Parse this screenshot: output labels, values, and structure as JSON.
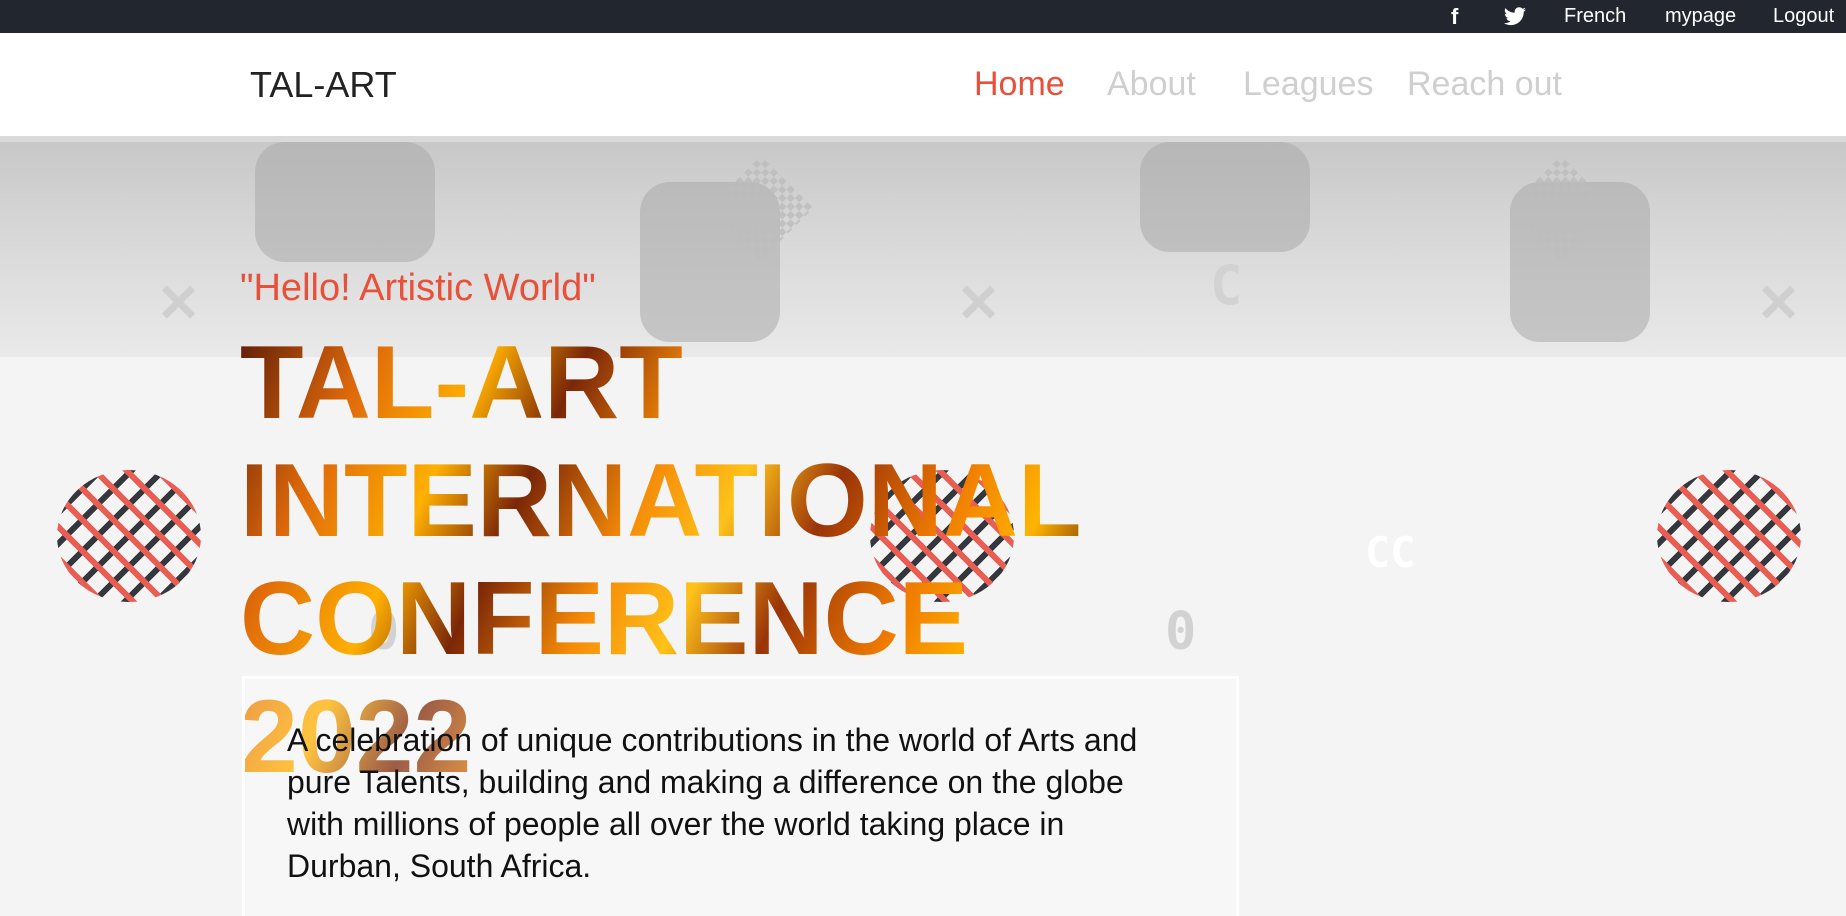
{
  "topbar": {
    "social": [
      {
        "icon": "facebook-icon",
        "glyph": "f"
      },
      {
        "icon": "twitter-icon",
        "glyph": "🐦"
      }
    ],
    "language_label": "French",
    "mypage_label": "mypage",
    "logout_label": "Logout"
  },
  "navbar": {
    "brand": "TAL-ART",
    "links": [
      {
        "label": "Home",
        "active": true
      },
      {
        "label": "About",
        "active": false
      },
      {
        "label": "Leagues",
        "active": false
      },
      {
        "label": "Reach out",
        "active": false
      }
    ]
  },
  "hero": {
    "tagline": "\"Hello! Artistic World\"",
    "headline": "TAL-ART INTERNATIONAL CONFERENCE 2022",
    "description": "A celebration of unique contributions in the world of Arts and pure Talents, building and making a difference on the globe with millions of people all over the world taking place in Durban, South Africa."
  },
  "colors": {
    "topbar_bg": "#22262f",
    "accent": "#e8503a",
    "nav_inactive": "#cfcfcf"
  }
}
